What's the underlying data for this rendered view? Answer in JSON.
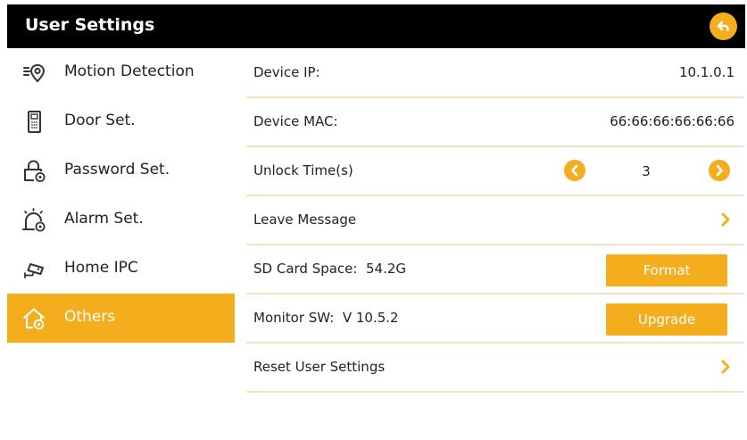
{
  "header": {
    "title": "User Settings",
    "back_icon": "back-arrow-icon"
  },
  "sidebar": {
    "items": [
      {
        "label": "Motion Detection",
        "icon": "motion-detection-icon",
        "active": false
      },
      {
        "label": "Door Set.",
        "icon": "door-icon",
        "active": false
      },
      {
        "label": "Password Set.",
        "icon": "password-lock-icon",
        "active": false
      },
      {
        "label": "Alarm Set.",
        "icon": "alarm-icon",
        "active": false
      },
      {
        "label": "Home IPC",
        "icon": "camera-icon",
        "active": false
      },
      {
        "label": "Others",
        "icon": "home-gear-icon",
        "active": true
      }
    ]
  },
  "content": {
    "device_ip": {
      "label": "Device IP:",
      "value": "10.1.0.1"
    },
    "device_mac": {
      "label": "Device MAC:",
      "value": "66:66:66:66:66:66"
    },
    "unlock_time": {
      "label": "Unlock Time(s)",
      "value": "3"
    },
    "leave_message": {
      "label": "Leave Message"
    },
    "sd_card": {
      "label": "SD Card Space:  54.2G",
      "button": "Format"
    },
    "monitor_sw": {
      "label": "Monitor SW:  V 10.5.2",
      "button": "Upgrade"
    },
    "reset": {
      "label": "Reset User Settings"
    }
  },
  "colors": {
    "accent": "#f4ad1c",
    "header_bg": "#000000",
    "divider": "#f5e2bf"
  }
}
